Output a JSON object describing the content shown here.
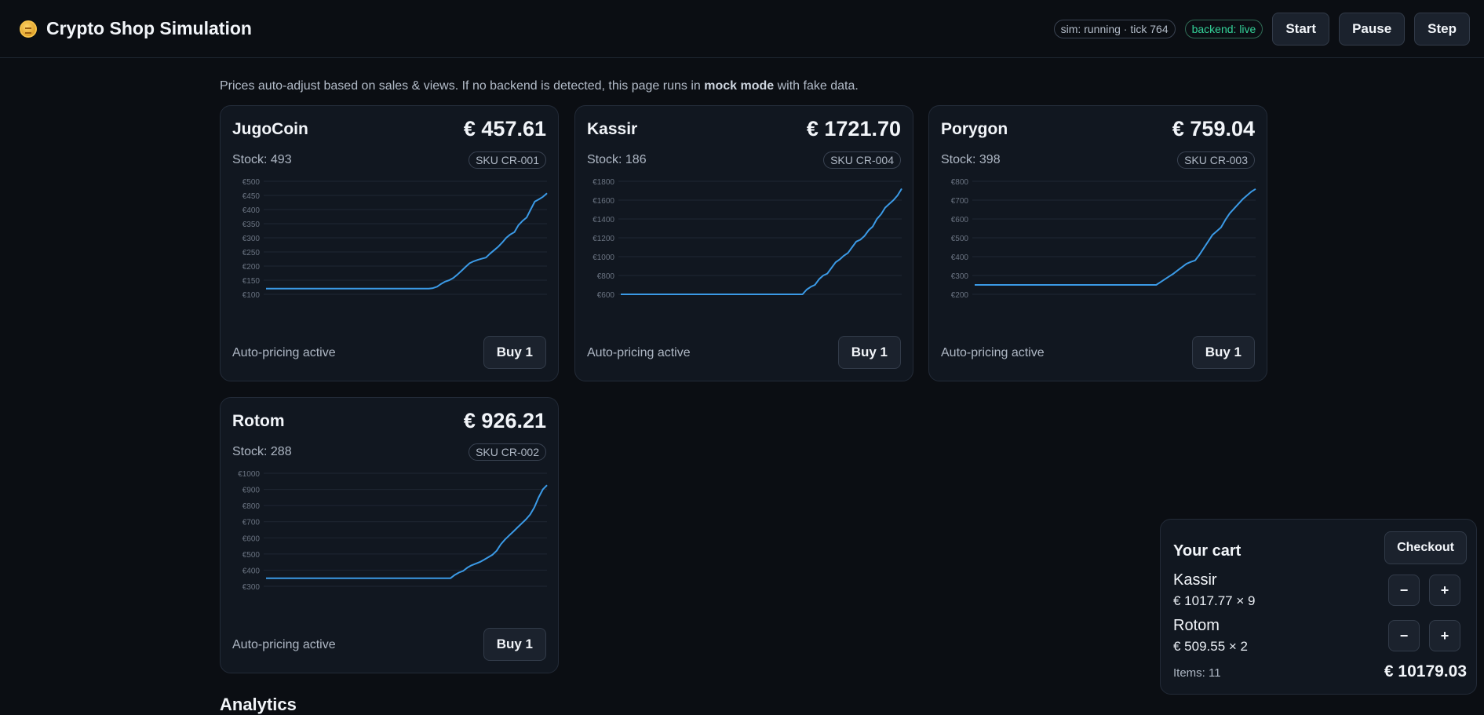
{
  "app": {
    "title": "Crypto Shop Simulation",
    "sim_status": "sim: running · tick 764",
    "backend_status": "backend: live",
    "buttons": {
      "start": "Start",
      "pause": "Pause",
      "step": "Step"
    }
  },
  "note": {
    "before": "Prices auto-adjust based on sales & views. If no backend is detected, this page runs in ",
    "bold": "mock mode",
    "after": " with fake data."
  },
  "products": [
    {
      "name": "JugoCoin",
      "price": "€ 457.61",
      "stock": "Stock: 493",
      "sku": "SKU CR-001",
      "auto": "Auto-pricing active",
      "buy": "Buy 1"
    },
    {
      "name": "Kassir",
      "price": "€ 1721.70",
      "stock": "Stock: 186",
      "sku": "SKU CR-004",
      "auto": "Auto-pricing active",
      "buy": "Buy 1"
    },
    {
      "name": "Porygon",
      "price": "€ 759.04",
      "stock": "Stock: 398",
      "sku": "SKU CR-003",
      "auto": "Auto-pricing active",
      "buy": "Buy 1"
    },
    {
      "name": "Rotom",
      "price": "€ 926.21",
      "stock": "Stock: 288",
      "sku": "SKU CR-002",
      "auto": "Auto-pricing active",
      "buy": "Buy 1"
    }
  ],
  "chart_data": [
    {
      "type": "line",
      "title": "",
      "series": [
        {
          "values": [
            120,
            120,
            120,
            120,
            120,
            120,
            120,
            120,
            120,
            120,
            120,
            120,
            120,
            120,
            120,
            120,
            120,
            120,
            120,
            120,
            120,
            120,
            120,
            120,
            120,
            120,
            120,
            120,
            120,
            120,
            120,
            120,
            120,
            120,
            120,
            120,
            120,
            120,
            120,
            120,
            120,
            122,
            127,
            137,
            145,
            150,
            158,
            170,
            183,
            197,
            210,
            217,
            222,
            226,
            230,
            244,
            256,
            268,
            283,
            300,
            312,
            320,
            345,
            360,
            372,
            400,
            428,
            436,
            445,
            457.61
          ]
        }
      ],
      "ylim": [
        100,
        500
      ],
      "yticks": [
        "€100",
        "€150",
        "€200",
        "€250",
        "€300",
        "€350",
        "€400",
        "€450",
        "€500"
      ],
      "grid": true
    },
    {
      "type": "line",
      "title": "",
      "series": [
        {
          "values": [
            600,
            600,
            600,
            600,
            600,
            600,
            600,
            600,
            600,
            600,
            600,
            600,
            600,
            600,
            600,
            600,
            600,
            600,
            600,
            600,
            600,
            600,
            600,
            600,
            600,
            600,
            600,
            600,
            600,
            600,
            600,
            600,
            600,
            600,
            600,
            600,
            600,
            600,
            600,
            600,
            600,
            600,
            600,
            600,
            600,
            650,
            680,
            700,
            760,
            800,
            820,
            880,
            940,
            970,
            1010,
            1040,
            1100,
            1160,
            1180,
            1220,
            1280,
            1320,
            1400,
            1450,
            1520,
            1560,
            1600,
            1650,
            1721.7
          ]
        }
      ],
      "ylim": [
        600,
        1800
      ],
      "yticks": [
        "€600",
        "€800",
        "€1000",
        "€1200",
        "€1400",
        "€1600",
        "€1800"
      ],
      "grid": true
    },
    {
      "type": "line",
      "title": "",
      "series": [
        {
          "values": [
            250,
            250,
            250,
            250,
            250,
            250,
            250,
            250,
            250,
            250,
            250,
            250,
            250,
            250,
            250,
            250,
            250,
            250,
            250,
            250,
            250,
            250,
            250,
            250,
            250,
            250,
            250,
            250,
            250,
            250,
            250,
            250,
            250,
            250,
            250,
            250,
            250,
            250,
            250,
            250,
            250,
            250,
            250,
            265,
            280,
            295,
            310,
            328,
            345,
            362,
            372,
            380,
            410,
            445,
            480,
            515,
            535,
            555,
            595,
            630,
            655,
            680,
            705,
            725,
            745,
            759.04
          ]
        }
      ],
      "ylim": [
        200,
        800
      ],
      "yticks": [
        "€200",
        "€300",
        "€400",
        "€500",
        "€600",
        "€700",
        "€800"
      ],
      "grid": true
    },
    {
      "type": "line",
      "title": "",
      "series": [
        {
          "values": [
            350,
            350,
            350,
            350,
            350,
            350,
            350,
            350,
            350,
            350,
            350,
            350,
            350,
            350,
            350,
            350,
            350,
            350,
            350,
            350,
            350,
            350,
            350,
            350,
            350,
            350,
            350,
            350,
            350,
            350,
            350,
            350,
            350,
            350,
            350,
            350,
            350,
            350,
            350,
            350,
            350,
            350,
            350,
            350,
            350,
            370,
            385,
            395,
            415,
            430,
            440,
            450,
            465,
            480,
            495,
            520,
            560,
            590,
            615,
            640,
            665,
            690,
            715,
            745,
            790,
            850,
            900,
            926.21
          ]
        }
      ],
      "ylim": [
        300,
        1000
      ],
      "yticks": [
        "€300",
        "€400",
        "€500",
        "€600",
        "€700",
        "€800",
        "€900",
        "€1000"
      ],
      "grid": true
    }
  ],
  "cart": {
    "title": "Your cart",
    "checkout": "Checkout",
    "items": [
      {
        "name": "Kassir",
        "detail": "€ 1017.77 × 9"
      },
      {
        "name": "Rotom",
        "detail": "€ 509.55 × 2"
      }
    ],
    "minus": "−",
    "plus": "+",
    "items_count": "Items: 11",
    "total": "€ 10179.03"
  },
  "analytics_heading": "Analytics",
  "colors": {
    "line": "#3b9ae6",
    "grid": "#1f2733",
    "tick": "#6b7482"
  }
}
